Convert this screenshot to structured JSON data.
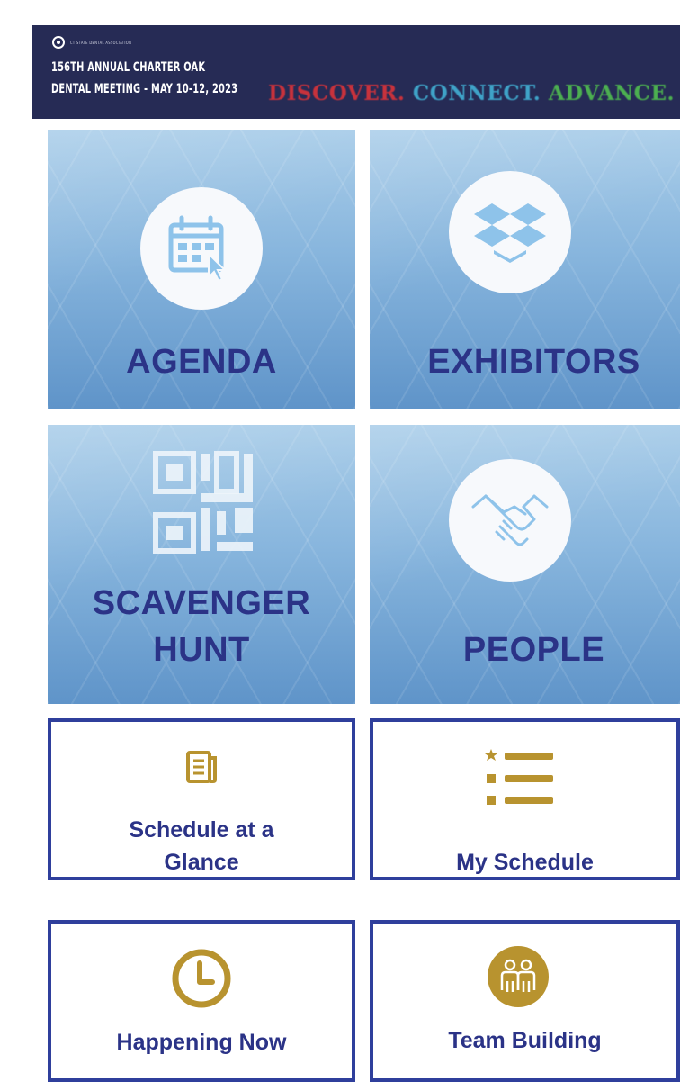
{
  "header": {
    "org_name": "CT STATE DENTAL ASSOCIATION",
    "title_line1": "156TH ANNUAL CHARTER OAK",
    "title_line2": "DENTAL MEETING - MAY 10-12, 2023",
    "tagline": {
      "discover": "DISCOVER.",
      "connect": "CONNECT.",
      "advance": "ADVANCE.",
      "colors": {
        "discover": "#c8323c",
        "connect": "#3fa3c8",
        "advance": "#4caf50"
      }
    }
  },
  "tiles": {
    "agenda": {
      "label": "AGENDA",
      "icon": "calendar-cursor-icon"
    },
    "exhibitors": {
      "label": "EXHIBITORS",
      "icon": "boxes-icon"
    },
    "scavenger": {
      "label_line1": "SCAVENGER",
      "label_line2": "HUNT",
      "icon": "qr-code-icon"
    },
    "people": {
      "label": "PEOPLE",
      "icon": "handshake-icon"
    },
    "schedule_glance": {
      "label_line1": "Schedule at a",
      "label_line2": "Glance",
      "icon": "document-icon"
    },
    "my_schedule": {
      "label": "My Schedule",
      "icon": "star-list-icon"
    },
    "happening_now": {
      "label": "Happening Now",
      "icon": "clock-icon"
    },
    "team_building": {
      "label": "Team Building",
      "icon": "team-icon"
    }
  },
  "colors": {
    "header_bg": "#262b55",
    "tile_text": "#2b3387",
    "border": "#2f3f9c",
    "gold": "#b8932f"
  }
}
